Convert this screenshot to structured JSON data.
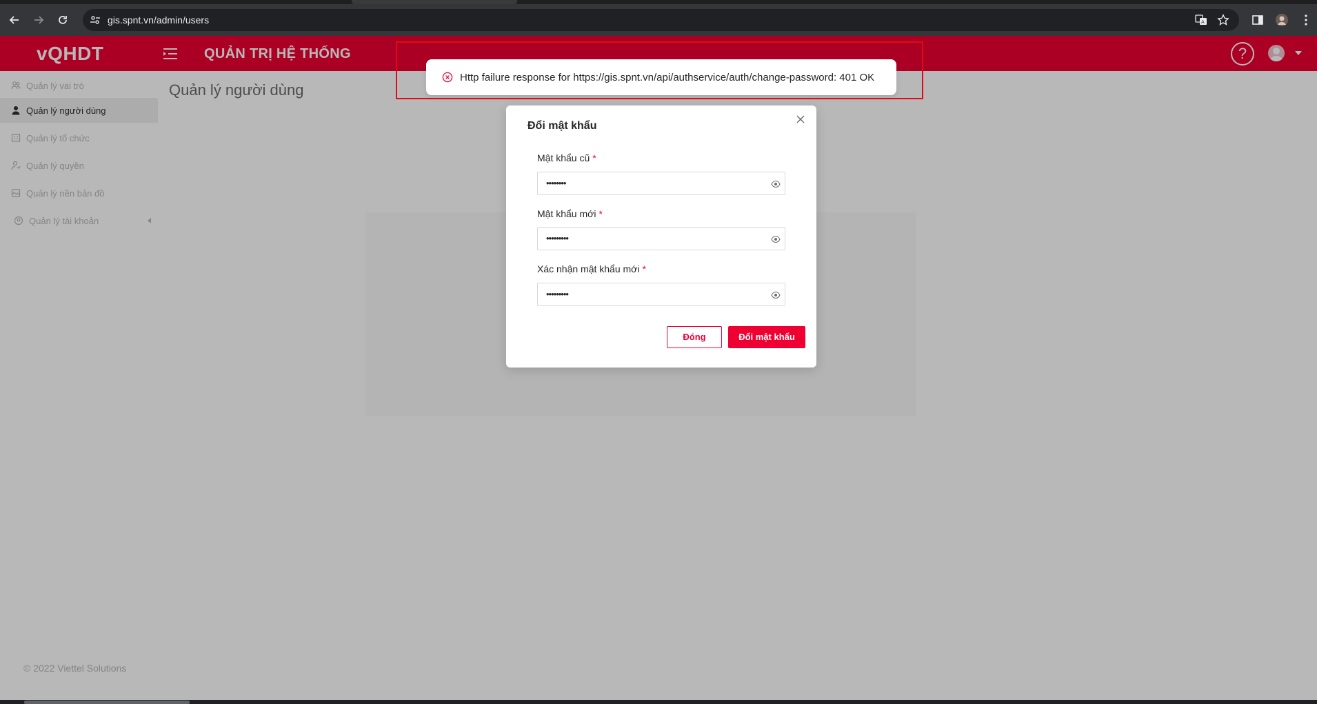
{
  "browser": {
    "url": "gis.spnt.vn/admin/users"
  },
  "app": {
    "logo": "vQHDT",
    "system_title": "QUẢN TRỊ HỆ THỐNG",
    "help_label": "?",
    "brand_color": "#ee0033"
  },
  "sidebar": {
    "items": [
      {
        "label": "Quản lý vai trò",
        "icon": "users-group-icon",
        "active": false
      },
      {
        "label": "Quản lý người dùng",
        "icon": "user-icon",
        "active": true
      },
      {
        "label": "Quản lý tổ chức",
        "icon": "organization-icon",
        "active": false
      },
      {
        "label": "Quản lý quyền",
        "icon": "permission-icon",
        "active": false
      },
      {
        "label": "Quản lý nền bản đồ",
        "icon": "map-layer-icon",
        "active": false
      },
      {
        "label": "Quản lý tài khoản",
        "icon": "account-icon",
        "active": false
      }
    ],
    "copyright": "© 2022 Viettel Solutions"
  },
  "content": {
    "page_title": "Quản lý người dùng"
  },
  "modal": {
    "title": "Đổi mật khẩu",
    "fields": [
      {
        "label": "Mật khẩu cũ",
        "required_mark": "*",
        "masked_value": "••••••••"
      },
      {
        "label": "Mật khẩu mới",
        "required_mark": "*",
        "masked_value": "•••••••••"
      },
      {
        "label": "Xác nhận mật khẩu mới",
        "required_mark": "*",
        "masked_value": "•••••••••"
      }
    ],
    "cancel_label": "Đóng",
    "submit_label": "Đổi mật khẩu"
  },
  "toast": {
    "type": "error",
    "message": "Http failure response for https://gis.spnt.vn/api/authservice/auth/change-password: 401 OK",
    "highlight_color": "#e10a14"
  }
}
